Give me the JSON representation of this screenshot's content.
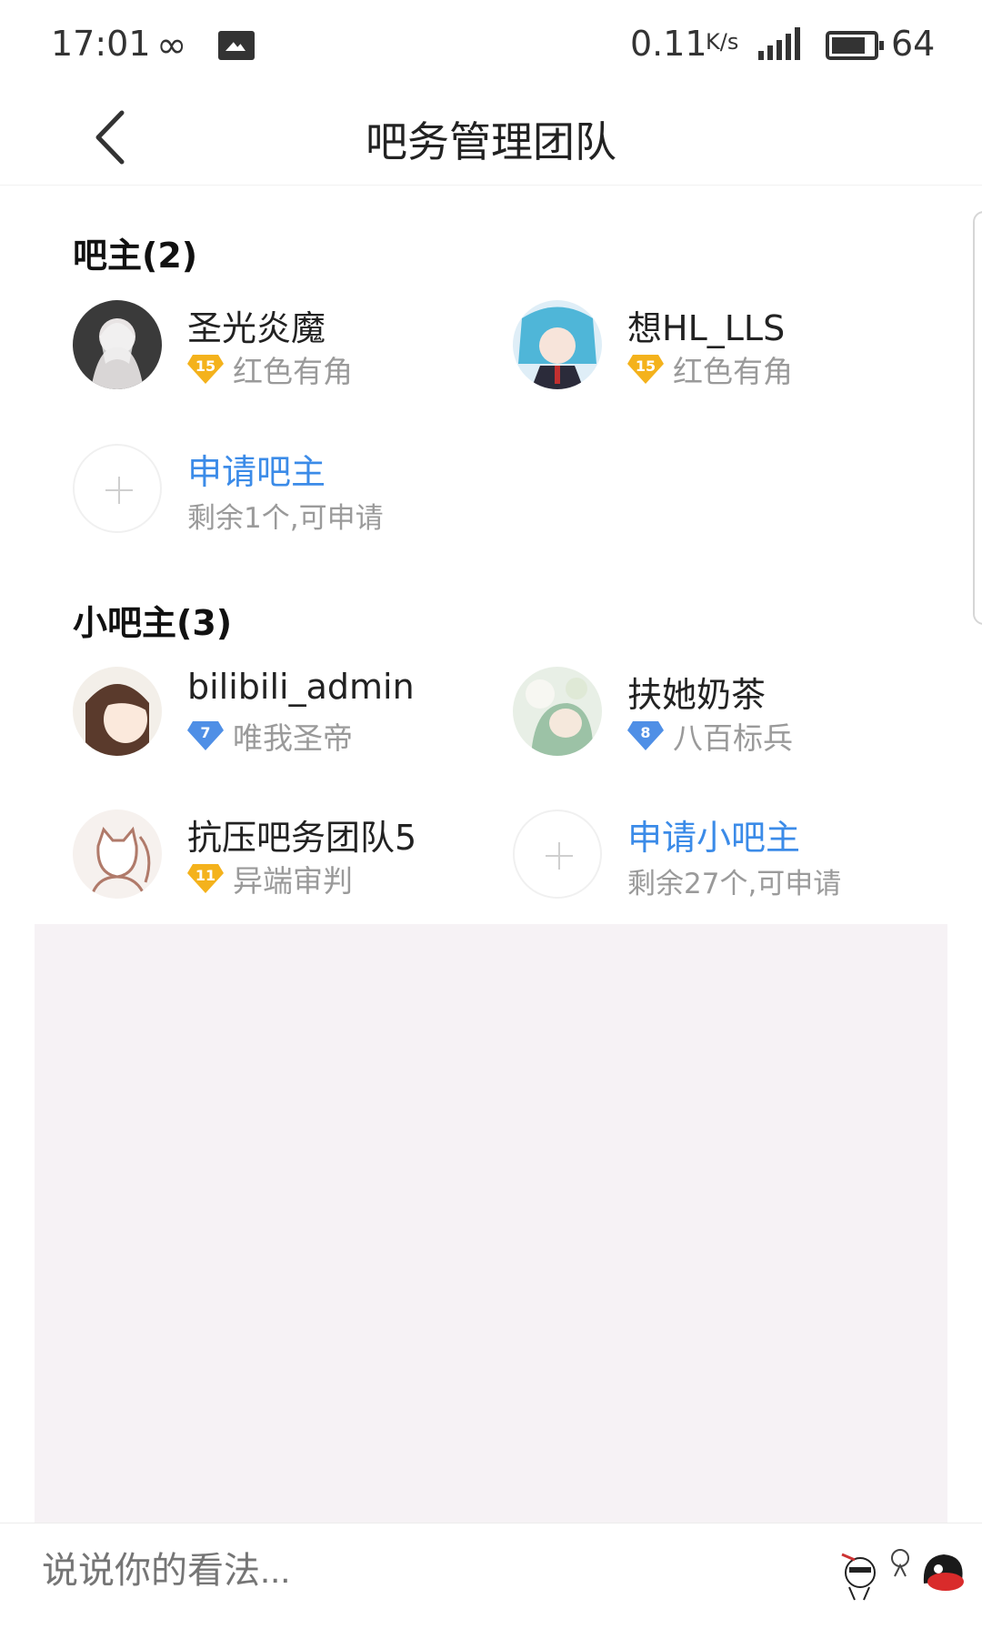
{
  "status_bar": {
    "time": "17:01",
    "net_speed": "0.11",
    "net_unit": "K/s",
    "network_type": "4G",
    "battery": "64"
  },
  "header": {
    "title": "吧务管理团队"
  },
  "owners": {
    "title": "吧主(2)",
    "members": [
      {
        "name": "圣光炎魔",
        "level": "15",
        "rank": "红色有角",
        "badge_color": "#f4b21c"
      },
      {
        "name": "想HL_LLS",
        "level": "15",
        "rank": "红色有角",
        "badge_color": "#f4b21c"
      }
    ],
    "apply": {
      "label": "申请吧主",
      "remaining": "剩余1个,可申请"
    }
  },
  "sub_owners": {
    "title": "小吧主(3)",
    "members": [
      {
        "name": "bilibili_admin",
        "level": "7",
        "rank": "唯我圣帝",
        "badge_color": "#4f8fe6"
      },
      {
        "name": "扶她奶茶",
        "level": "8",
        "rank": "八百标兵",
        "badge_color": "#4f8fe6"
      },
      {
        "name": "抗压吧务团队5",
        "level": "11",
        "rank": "异端审判",
        "badge_color": "#f4b21c"
      }
    ],
    "apply": {
      "label": "申请小吧主",
      "remaining": "剩余27个,可申请"
    }
  },
  "comment": {
    "placeholder": "说说你的看法..."
  },
  "colors": {
    "accent": "#3b8be8",
    "muted_text": "#9a9a9a",
    "panel_bg": "#f6f2f5"
  },
  "icons": [
    "back-arrow-icon",
    "infinity-icon",
    "image-notification-icon",
    "signal-icon",
    "battery-icon",
    "plus-icon",
    "level-badge-icon",
    "sticker-icon"
  ]
}
